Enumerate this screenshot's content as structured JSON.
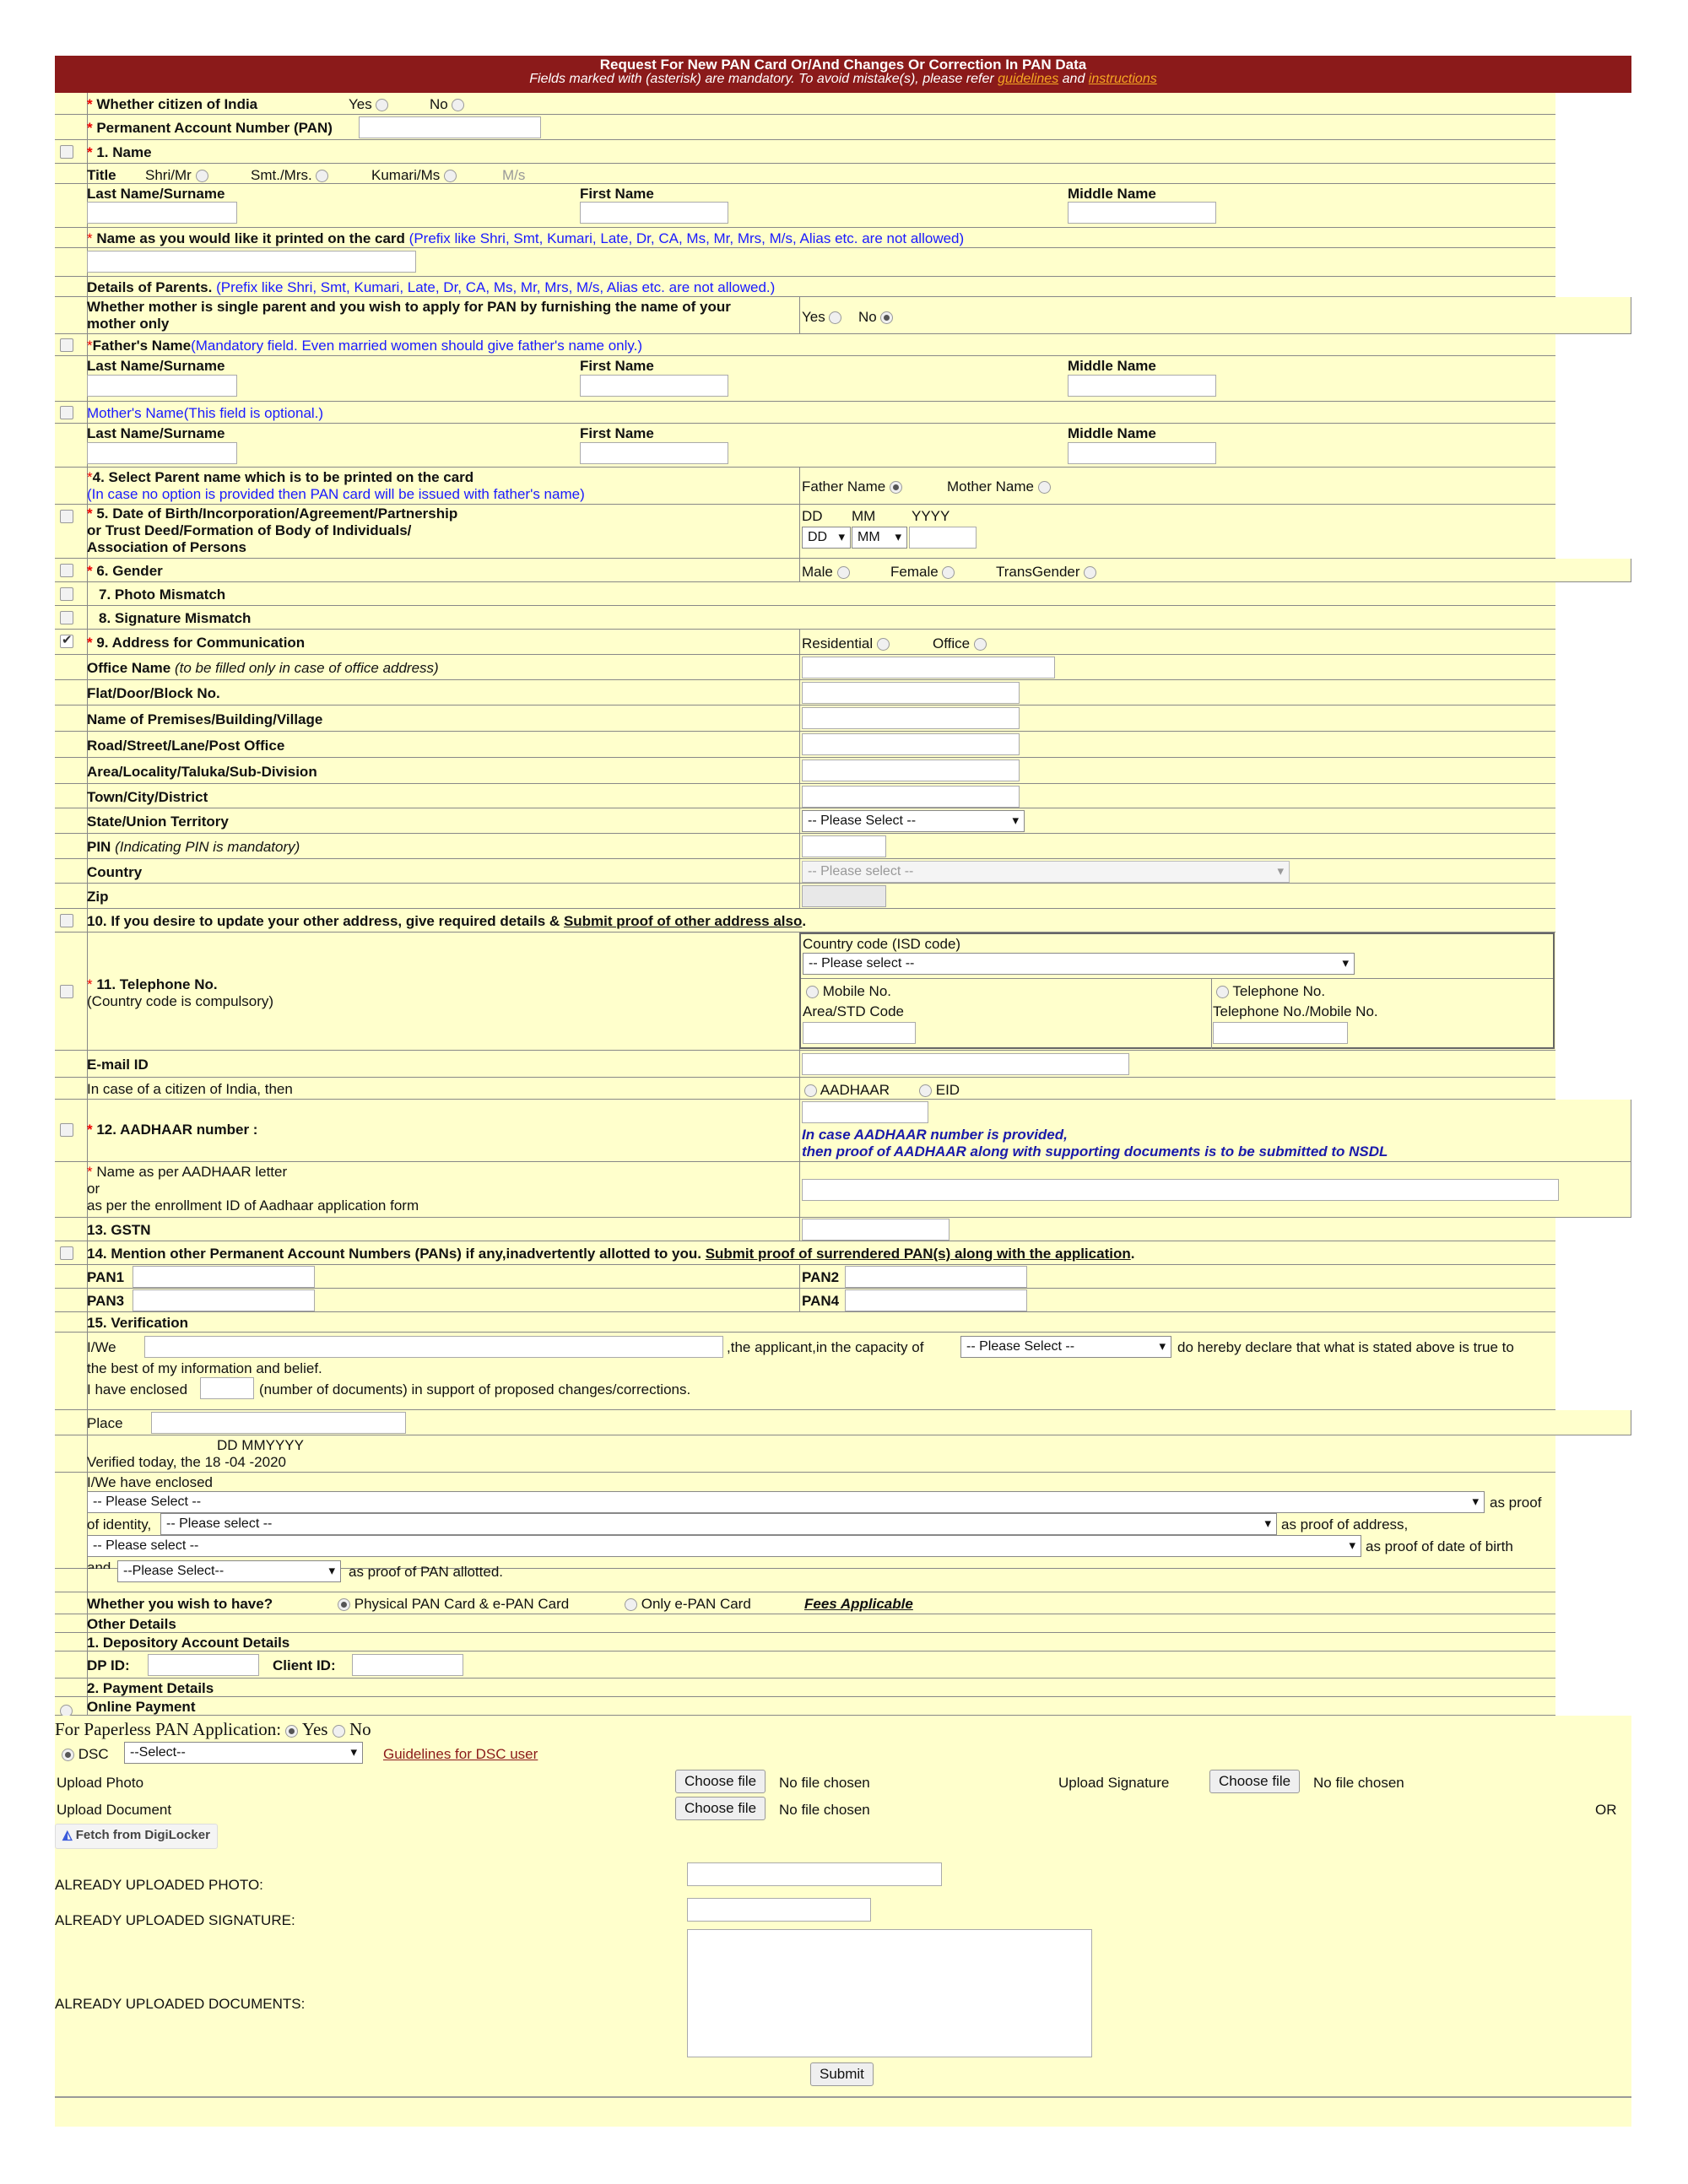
{
  "banner": {
    "title": "Request For New PAN Card Or/And Changes Or Correction In PAN Data",
    "subtitle_pre": "Fields marked with   (asterisk) are mandatory.   To avoid mistake(s), please refer ",
    "guidelines": "guidelines",
    "and": " and ",
    "instructions": "instructions"
  },
  "citizen": {
    "label": "Whether citizen of India",
    "yes": "Yes",
    "no": "No"
  },
  "pan": {
    "label": "Permanent Account Number (PAN)"
  },
  "name": {
    "section": "1. Name",
    "title_label": "Title",
    "shri": "Shri/Mr",
    "smt": "Smt./Mrs.",
    "kumari": "Kumari/Ms",
    "ms": "M/s",
    "last": "Last Name/Surname",
    "first": "First Name",
    "middle": "Middle Name",
    "print_label": "Name as you would like it printed on the card",
    "print_note": "(Prefix like Shri, Smt, Kumari, Late, Dr, CA, Ms, Mr, Mrs, M/s, Alias etc. are not allowed)"
  },
  "parents": {
    "details_label": "Details of Parents.",
    "details_note": "(Prefix like Shri, Smt, Kumari, Late, Dr, CA, Ms, Mr, Mrs, M/s, Alias etc. are not allowed.)",
    "single_q1": "Whether mother is single parent and you wish to apply for PAN by furnishing the name of your",
    "single_q2": "mother only",
    "yes": "Yes",
    "no": "No",
    "father_label": "Father's Name",
    "father_note": "(Mandatory field. Even married women should give father's name only.)",
    "mother_label": "Mother's Name(This field is optional.)",
    "last": "Last Name/Surname",
    "first": "First Name",
    "middle": "Middle Name",
    "select_label": "4. Select Parent name which is to be printed on the card",
    "select_note": "(In case no option is provided then PAN card will be issued with father's name)",
    "father_opt": "Father Name",
    "mother_opt": "Mother Name"
  },
  "dob": {
    "l1": "5. Date of Birth/Incorporation/Agreement/Partnership",
    "l2": "or Trust Deed/Formation of Body of Individuals/",
    "l3": "Association of Persons",
    "dd": "DD",
    "mm": "MM",
    "yyyy": "YYYY",
    "dd_sel": "DD",
    "mm_sel": "MM"
  },
  "gender": {
    "label": "6. Gender",
    "male": "Male",
    "female": "Female",
    "trans": "TransGender"
  },
  "photo_mismatch": "7. Photo Mismatch",
  "sig_mismatch": "8. Signature Mismatch",
  "address": {
    "label": "9. Address for Communication",
    "residential": "Residential",
    "office": "Office",
    "office_name": "Office Name",
    "office_note": "(to be filled only in case of office address)",
    "flat": "Flat/Door/Block No.",
    "premises": "Name of Premises/Building/Village",
    "road": "Road/Street/Lane/Post Office",
    "area": "Area/Locality/Taluka/Sub-Division",
    "town": "Town/City/District",
    "state": "State/Union Territory",
    "state_sel": "-- Please Select --",
    "pin": "PIN",
    "pin_note": "(Indicating PIN is mandatory)",
    "country": "Country",
    "country_sel": "-- Please select --",
    "zip": "Zip"
  },
  "other_address": {
    "pre": "10. If you desire to update your other address, give required details & ",
    "link": "Submit proof of other address also",
    "post": "."
  },
  "telephone": {
    "label": "11. Telephone No.",
    "note": "(Country code is compulsory)",
    "isd": "Country code (ISD code)",
    "isd_sel": "-- Please select --",
    "mobile": "Mobile No.",
    "tel": "Telephone No.",
    "std": "Area/STD Code",
    "telmob": "Telephone No./Mobile No."
  },
  "email": {
    "label": "E-mail ID"
  },
  "citizen_then": {
    "label": "In case of a citizen of India, then",
    "aadhaar": "AADHAAR",
    "eid": "EID"
  },
  "aadhaar": {
    "label": "12. AADHAAR number :",
    "note1": "In case AADHAAR number is provided,",
    "note2": "then proof of AADHAAR along with supporting documents is to be submitted to NSDL",
    "name1": "Name as per AADHAAR letter",
    "name2": "or",
    "name3": "as per the enrollment ID of Aadhaar application form"
  },
  "gstn": "13. GSTN",
  "other_pans": {
    "pre": "14. Mention other Permanent Account Numbers (PANs) if any,inadvertently allotted to you. ",
    "link": "Submit proof of surrendered PAN(s) along with the application",
    "post": ".",
    "pan1": "PAN1",
    "pan2": "PAN2",
    "pan3": "PAN3",
    "pan4": "PAN4"
  },
  "verification": {
    "label": "15. Verification",
    "iwe": "I/We",
    "capacity": ",the applicant,in the capacity of",
    "capacity_sel": "-- Please Select --",
    "declare": "do hereby declare that what is stated above is true to",
    "belief": "the best of my information and belief.",
    "enclosed_pre": "I have enclosed",
    "enclosed_post": "(number of documents) in support of proposed changes/corrections.",
    "place": "Place",
    "date_fmt": "DD MMYYYY",
    "verified": "Verified today, the",
    "date": "18 -04 -2020",
    "we_enclosed": "I/We have enclosed",
    "id_sel": "-- Please Select --",
    "as_proof": "as proof",
    "of_identity": "of identity,",
    "addr_sel": "-- Please select --",
    "as_addr": "as proof of address,",
    "dob_sel": "-- Please select --",
    "as_dob": "as proof of date of birth",
    "and": "and",
    "pan_sel": "--Please Select--",
    "as_pan": "as proof of PAN allotted."
  },
  "card_type": {
    "label": "Whether you wish to have?",
    "physical": "Physical PAN Card & e-PAN Card",
    "epan": "Only e-PAN Card",
    "fees": "Fees Applicable"
  },
  "other_details": {
    "label": "Other Details",
    "depository": "1. Depository Account Details",
    "dp_id": "DP ID:",
    "client_id": "Client ID:",
    "payment": "2. Payment Details",
    "online": "Online Payment"
  },
  "paperless": {
    "label": "For Paperless PAN Application:",
    "yes": "Yes",
    "no": "No"
  },
  "dsc": {
    "label": "DSC",
    "sel": "--Select--",
    "guidelines": "Guidelines for DSC user"
  },
  "upload": {
    "photo": "Upload Photo",
    "signature": "Upload Signature",
    "document": "Upload Document",
    "choose": "Choose file",
    "nofile": "No file chosen",
    "or": "OR",
    "digilocker": "Fetch from DigiLocker"
  },
  "already": {
    "photo": "ALREADY UPLOADED PHOTO:",
    "signature": "ALREADY UPLOADED SIGNATURE:",
    "documents": "ALREADY UPLOADED DOCUMENTS:"
  },
  "submit": "Submit"
}
